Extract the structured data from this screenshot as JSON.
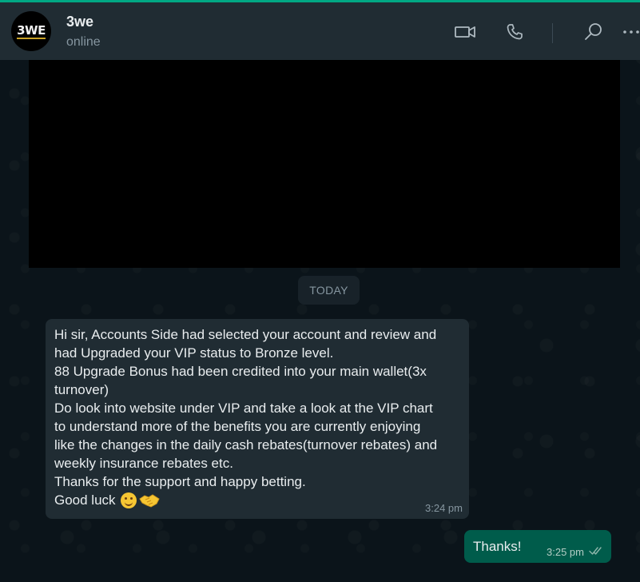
{
  "header": {
    "avatar_text": "3WE",
    "name": "3we",
    "status": "online",
    "icons": [
      "video-call-icon",
      "voice-call-icon",
      "search-icon",
      "menu-icon"
    ]
  },
  "date_divider": "TODAY",
  "incoming_message": {
    "lines": [
      "Hi sir, Accounts Side had selected your account and review and",
      "had Upgraded your VIP status to Bronze level.",
      "88 Upgrade Bonus had been credited into your main wallet(3x",
      "turnover)",
      "Do look into website under VIP and take a look at the VIP chart",
      "to understand more of the benefits you are currently enjoying",
      "like the changes in the daily cash rebates(turnover rebates) and",
      "weekly insurance rebates etc.",
      "Thanks for the support and happy betting.",
      "Good luck"
    ],
    "emojis": [
      "smiling-face-emoji",
      "handshake-emoji"
    ],
    "time": "3:24 pm"
  },
  "outgoing_message": {
    "text": "Thanks!",
    "time": "3:25 pm",
    "status": "read-double-tick"
  },
  "colors": {
    "accent": "#00a884",
    "header_bg": "#202c33",
    "chat_bg": "#0b141a",
    "incoming_bubble": "#202c33",
    "outgoing_bubble": "#005c4b"
  }
}
